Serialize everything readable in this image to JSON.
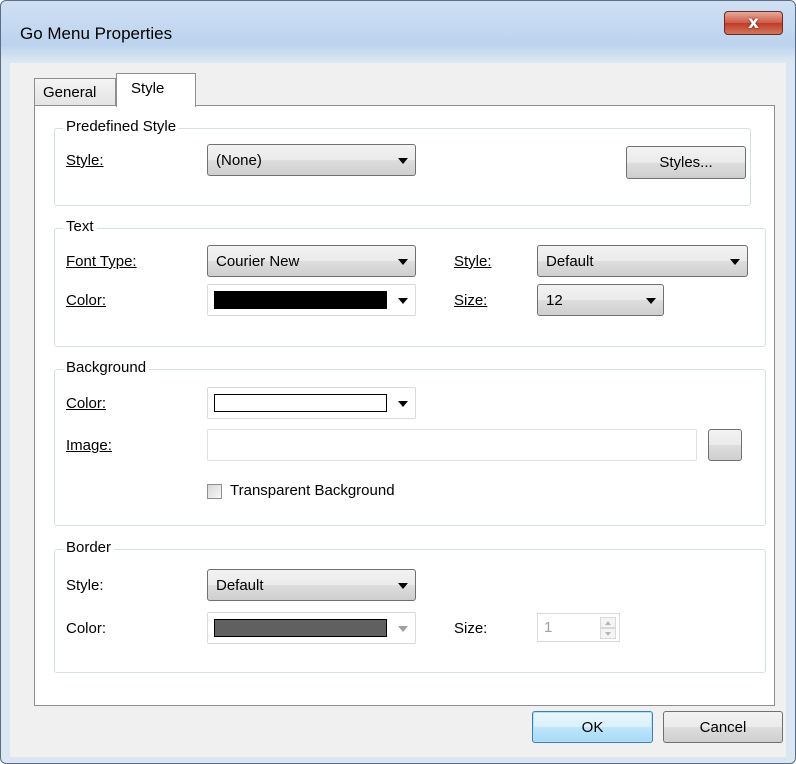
{
  "window": {
    "title": "Go Menu Properties",
    "close_glyph": "x"
  },
  "tabs": [
    {
      "label": "General",
      "active": false
    },
    {
      "label": "Style",
      "active": true
    }
  ],
  "predefined": {
    "title": "Predefined Style",
    "style_label": "Style:",
    "style_value": "(None)",
    "styles_button": "Styles..."
  },
  "text": {
    "title": "Text",
    "font_type_label": "Font Type:",
    "font_type_value": "Courier New",
    "style_label": "Style:",
    "style_value": "Default",
    "color_label": "Color:",
    "color_value": "#000000",
    "size_label": "Size:",
    "size_value": "12"
  },
  "background": {
    "title": "Background",
    "color_label": "Color:",
    "color_value": "#ffffff",
    "image_label": "Image:",
    "image_value": "",
    "transparent_label": "Transparent Background",
    "transparent_checked": false
  },
  "border": {
    "title": "Border",
    "style_label": "Style:",
    "style_value": "Default",
    "color_label": "Color:",
    "color_value": "#606060",
    "size_label": "Size:",
    "size_value": "1"
  },
  "buttons": {
    "ok": "OK",
    "cancel": "Cancel"
  }
}
